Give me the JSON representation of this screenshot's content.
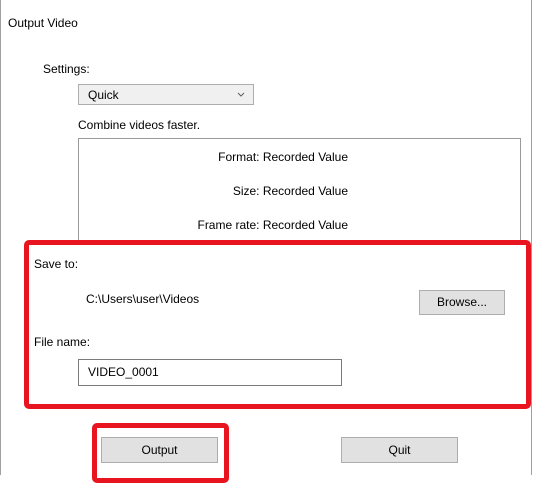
{
  "dialog": {
    "title": "Output Video"
  },
  "settings": {
    "label": "Settings:",
    "selected": "Quick",
    "description": "Combine videos faster."
  },
  "info": {
    "format": "Format: Recorded Value",
    "size": "Size: Recorded Value",
    "frame_rate": "Frame rate: Recorded Value"
  },
  "save": {
    "label": "Save to:",
    "path": "C:\\Users\\user\\Videos",
    "browse_label": "Browse..."
  },
  "file": {
    "label": "File name:",
    "value": "VIDEO_0001"
  },
  "buttons": {
    "output_label": "Output",
    "quit_label": "Quit"
  },
  "colors": {
    "highlight": "#e8141f",
    "button_face": "#e1e1e1",
    "button_border": "#adadad"
  },
  "icons": {
    "combo_arrow": "chevron-down-icon"
  }
}
